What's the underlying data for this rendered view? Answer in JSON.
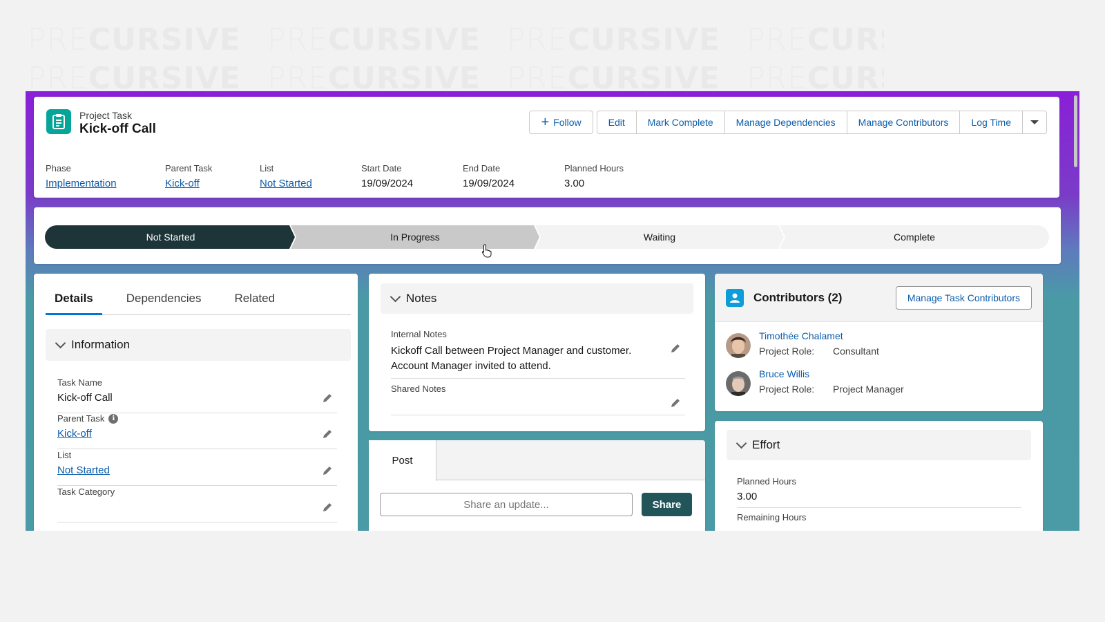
{
  "watermark": {
    "light": "PRE",
    "bold": "CURSIVE"
  },
  "record": {
    "object_type": "Project Task",
    "title": "Kick-off Call",
    "icon": "task-icon"
  },
  "actions": {
    "follow": "Follow",
    "edit": "Edit",
    "mark_complete": "Mark Complete",
    "manage_dependencies": "Manage Dependencies",
    "manage_contributors": "Manage Contributors",
    "log_time": "Log Time"
  },
  "highlights": [
    {
      "label": "Phase",
      "value": "Implementation",
      "link": true
    },
    {
      "label": "Parent Task",
      "value": "Kick-off",
      "link": true
    },
    {
      "label": "List",
      "value": "Not Started",
      "link": true
    },
    {
      "label": "Start Date",
      "value": "19/09/2024",
      "link": false
    },
    {
      "label": "End Date",
      "value": "19/09/2024",
      "link": false
    },
    {
      "label": "Planned Hours",
      "value": "3.00",
      "link": false
    }
  ],
  "path": {
    "stages": [
      "Not Started",
      "In Progress",
      "Waiting",
      "Complete"
    ],
    "current": "Not Started",
    "hovered": "In Progress"
  },
  "details": {
    "tabs": [
      "Details",
      "Dependencies",
      "Related"
    ],
    "active_tab": "Details",
    "section_title": "Information",
    "fields": [
      {
        "label": "Task Name",
        "value": "Kick-off Call",
        "link": false
      },
      {
        "label": "Parent Task",
        "value": "Kick-off",
        "link": true
      },
      {
        "label": "List",
        "value": "Not Started",
        "link": true
      },
      {
        "label": "Task Category",
        "value": "",
        "link": false
      }
    ]
  },
  "notes": {
    "section_title": "Notes",
    "internal_label": "Internal Notes",
    "internal_value": "Kickoff Call between Project Manager and customer. Account Manager invited to attend.",
    "shared_label": "Shared Notes",
    "shared_value": ""
  },
  "feed": {
    "tab": "Post",
    "placeholder": "Share an update...",
    "share": "Share"
  },
  "contributors": {
    "title": "Contributors (2)",
    "manage_button": "Manage Task Contributors",
    "role_label": "Project Role:",
    "people": [
      {
        "name": "Timothée Chalamet",
        "role": "Consultant"
      },
      {
        "name": "Bruce Willis",
        "role": "Project Manager"
      }
    ]
  },
  "effort": {
    "section_title": "Effort",
    "planned_label": "Planned Hours",
    "planned_value": "3.00",
    "remaining_label": "Remaining Hours"
  },
  "colors": {
    "path_current": "#1d3538",
    "path_hover": "#c9c9c9",
    "path_default": "#f3f3f3",
    "link": "#0b5cab",
    "task_icon": "#06a59a",
    "contributors_icon": "#0d9dda",
    "share_button": "#22555a"
  }
}
